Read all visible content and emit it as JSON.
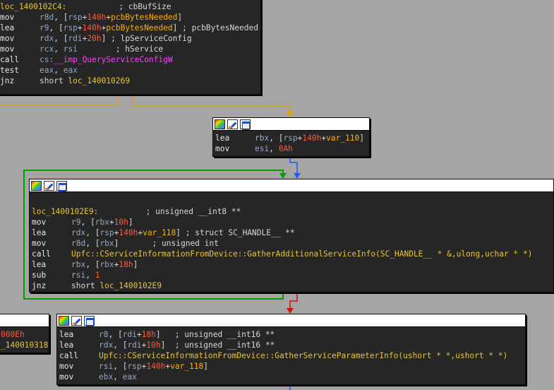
{
  "colors": {
    "background": "#a5a5a5",
    "node_bg": "#262626",
    "register": "#93a9c4",
    "variable": "#ffb000",
    "immediate": "#ff5a3c",
    "location": "#e6c43a",
    "import": "#ff3cff",
    "edge_true": "#00a000",
    "edge_false": "#cc1111",
    "edge_uncond": "#1a5cff",
    "edge_yellow": "#d9a21b"
  },
  "node_icons": [
    "color-palette-icon",
    "rename-pencil-icon",
    "graph-overview-icon"
  ],
  "node1": {
    "l0_loc": "loc_1400102C4:",
    "l0_cmt": "; cbBufSize",
    "l1_m": "mov",
    "l1_a": "r8d",
    "l1_b": ", [",
    "l1_c": "rsp",
    "l1_d": "+",
    "l1_e": "140h",
    "l1_f": "+",
    "l1_g": "pcbBytesNeeded",
    "l1_h": "]",
    "l2_m": "lea",
    "l2_a": "r9",
    "l2_b": ", [",
    "l2_c": "rsp",
    "l2_d": "+",
    "l2_e": "140h",
    "l2_f": "+",
    "l2_g": "pcbBytesNeeded",
    "l2_h": "]",
    "l2_cmt": " ; pcbBytesNeeded",
    "l3_m": "mov",
    "l3_a": "rdx",
    "l3_b": ", [",
    "l3_c": "rdi",
    "l3_d": "+",
    "l3_e": "20h",
    "l3_h": "]",
    "l3_cmt": " ; lpServiceConfig",
    "l4_m": "mov",
    "l4_a": "rcx",
    "l4_b": ", ",
    "l4_c": "rsi",
    "l4_cmt": "; hService",
    "l5_m": "call",
    "l5_a": "cs:",
    "l5_b": "__imp_QueryServiceConfigW",
    "l6_m": "test",
    "l6_a": "eax",
    "l6_b": ", ",
    "l6_c": "eax",
    "l7_m": "jnz",
    "l7_a": "short ",
    "l7_b": "loc_140010269"
  },
  "node2": {
    "l0_m": "lea",
    "l0_a": "rbx",
    "l0_b": ", [",
    "l0_c": "rsp",
    "l0_d": "+",
    "l0_e": "140h",
    "l0_f": "+",
    "l0_g": "var_110",
    "l0_h": "]",
    "l1_m": "mov",
    "l1_a": "esi",
    "l1_b": ", ",
    "l1_c": "0Ah"
  },
  "node3": {
    "l0_loc": "loc_1400102E9:",
    "l0_cmt": "; unsigned __int8 **",
    "l1_m": "mov",
    "l1_a": "r9",
    "l1_b": ", [",
    "l1_c": "rbx",
    "l1_d": "+",
    "l1_e": "10h",
    "l1_h": "]",
    "l2_m": "lea",
    "l2_a": "rdx",
    "l2_b": ", [",
    "l2_c": "rsp",
    "l2_d": "+",
    "l2_e": "140h",
    "l2_f": "+",
    "l2_g": "var_118",
    "l2_h": "]",
    "l2_cmt": " ; struct SC_HANDLE__ **",
    "l3_m": "mov",
    "l3_a": "r8d",
    "l3_b": ", [",
    "l3_c": "rbx",
    "l3_h": "]",
    "l3_cmt": " ; unsigned int",
    "l4_m": "call",
    "l4_a": "Upfc::CServiceInformationFromDevice::GatherAdditionalServiceInfo(SC_HANDLE__ * &,ulong,uchar * *)",
    "l5_m": "lea",
    "l5_a": "rbx",
    "l5_b": ", [",
    "l5_c": "rbx",
    "l5_d": "+",
    "l5_e": "18h",
    "l5_h": "]",
    "l6_m": "sub",
    "l6_a": "rsi",
    "l6_b": ", ",
    "l6_c": "1",
    "l7_m": "jnz",
    "l7_a": "short ",
    "l7_b": "loc_1400102E9"
  },
  "node4": {
    "l0_a": "000Eh",
    "l1_a": "_140010318"
  },
  "node5": {
    "l0_m": "lea",
    "l0_a": "r8",
    "l0_b": ", [",
    "l0_c": "rdi",
    "l0_d": "+",
    "l0_e": "18h",
    "l0_h": "]",
    "l0_cmt": "   ; unsigned __int16 **",
    "l1_m": "lea",
    "l1_a": "rdx",
    "l1_b": ", [",
    "l1_c": "rdi",
    "l1_d": "+",
    "l1_e": "10h",
    "l1_h": "]",
    "l1_cmt": "  ; unsigned __int16 **",
    "l2_m": "call",
    "l2_a": "Upfc::CServiceInformationFromDevice::GatherServiceParameterInfo(ushort * *,ushort * *)",
    "l3_m": "mov",
    "l3_a": "rsi",
    "l3_b": ", [",
    "l3_c": "rsp",
    "l3_d": "+",
    "l3_e": "140h",
    "l3_f": "+",
    "l3_g": "var_118",
    "l3_h": "]",
    "l4_m": "mov",
    "l4_a": "ebx",
    "l4_b": ", ",
    "l4_c": "eax"
  }
}
